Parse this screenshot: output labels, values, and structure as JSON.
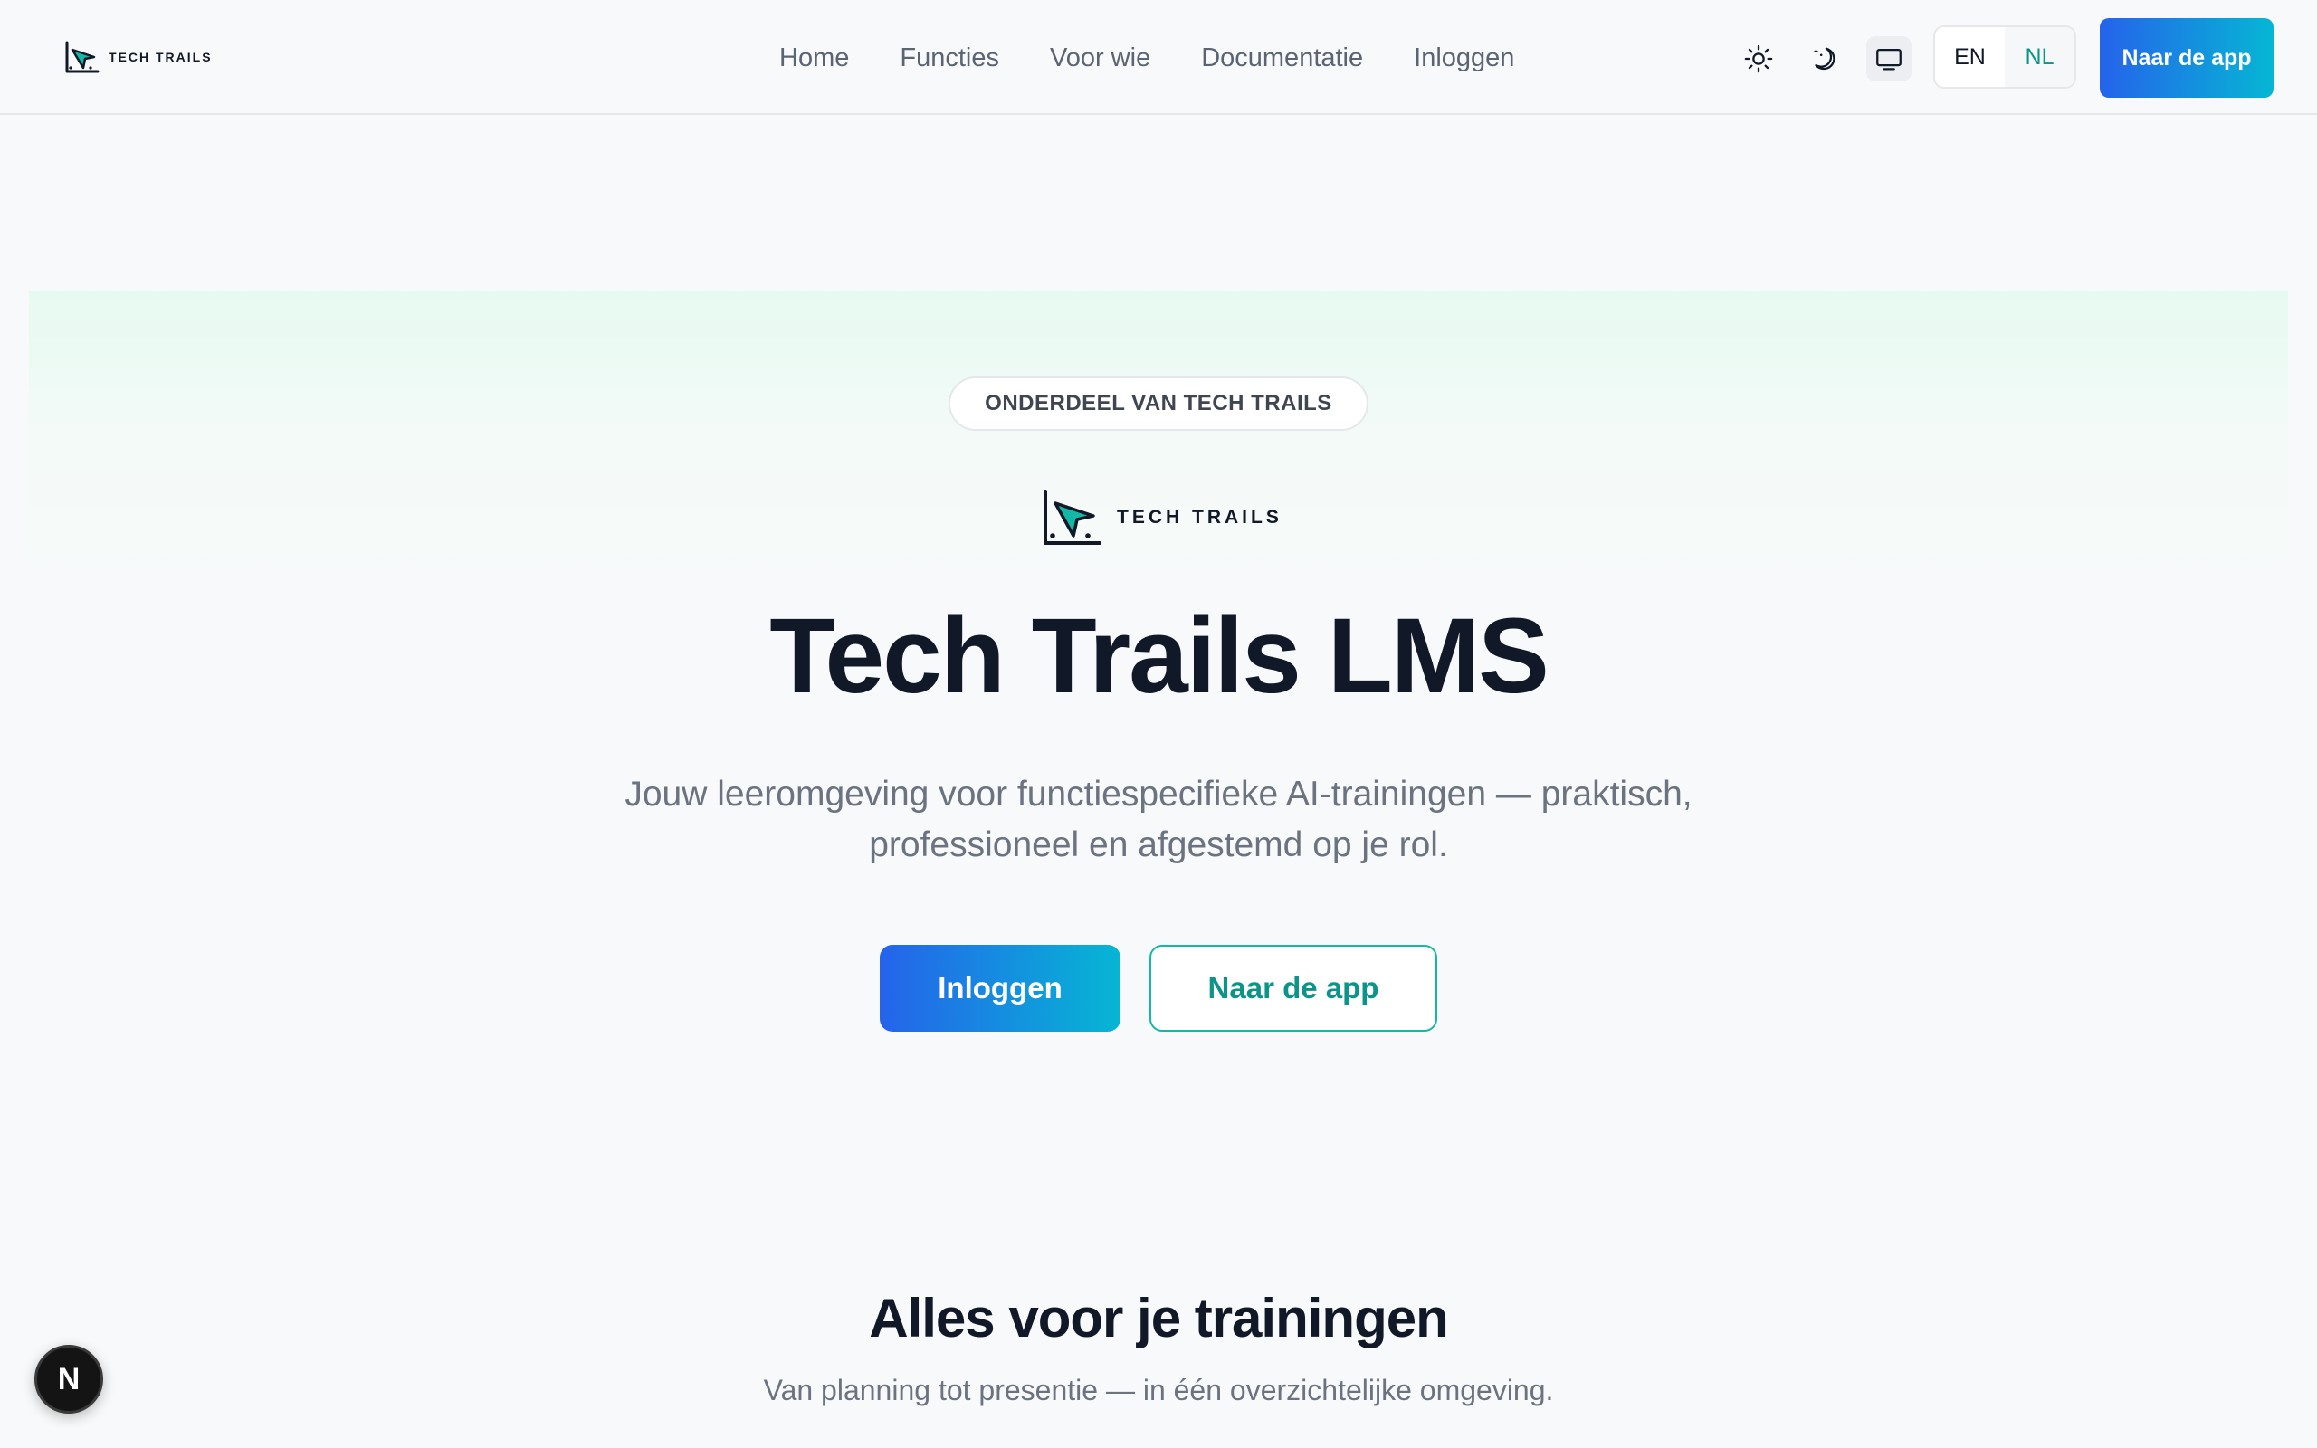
{
  "header": {
    "brand": "TECH TRAILS",
    "nav": [
      "Home",
      "Functies",
      "Voor wie",
      "Documentatie",
      "Inloggen"
    ],
    "theme_icons": [
      "sun-icon",
      "moon-icon",
      "monitor-icon"
    ],
    "languages": [
      "EN",
      "NL"
    ],
    "active_language": "NL",
    "cta_label": "Naar de app"
  },
  "hero": {
    "badge": "ONDERDEEL VAN TECH TRAILS",
    "logo_text": "TECH TRAILS",
    "title": "Tech Trails LMS",
    "subtitle": "Jouw leeromgeving voor functiespecifieke AI-trainingen — praktisch, professioneel en afgestemd op je rol.",
    "primary_button": "Inloggen",
    "secondary_button": "Naar de app"
  },
  "features": {
    "title": "Alles voor je trainingen",
    "subtitle": "Van planning tot presentie — in één overzichtelijke omgeving."
  },
  "floating_button": {
    "label": "N"
  },
  "colors": {
    "accent_blue": "#2563eb",
    "accent_cyan": "#06b6d4",
    "teal": "#0d9488",
    "background": "#f8f9fa",
    "text_dark": "#111827",
    "text_muted": "#6b7280"
  }
}
